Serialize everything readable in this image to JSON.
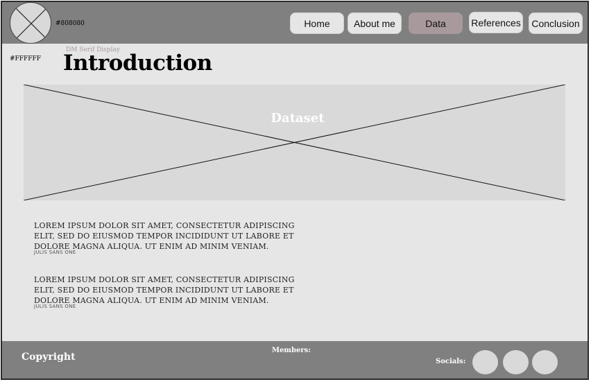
{
  "header": {
    "color_label": "#808080",
    "nav": {
      "home": "Home",
      "about": "About me",
      "data": "Data",
      "references": "References",
      "conclusion": "Conclusion"
    }
  },
  "main": {
    "color_label": "#FFFFFF",
    "font_hint": "DM Serif Display",
    "title": "Introduction",
    "dataset_label": "Dataset",
    "paragraphs": [
      {
        "text": "Lorem ipsum dolor sit amet, consectetur adipiscing elit, sed do eiusmod tempor incididunt ut labore et dolore magna aliqua. Ut enim ad minim veniam.",
        "font_label": "Julis Sans One"
      },
      {
        "text": "Lorem ipsum dolor sit amet, consectetur adipiscing elit, sed do eiusmod tempor incididunt ut labore et dolore magna aliqua. Ut enim ad minim veniam.",
        "font_label": "Julis Sans One"
      }
    ]
  },
  "footer": {
    "copyright": "Copyright",
    "members": "Members:",
    "socials": "Socials:"
  },
  "colors": {
    "header_bg": "#808080",
    "page_bg": "#e6e6e6",
    "accent": "#a89a9c",
    "placeholder": "#d9d9d9"
  }
}
